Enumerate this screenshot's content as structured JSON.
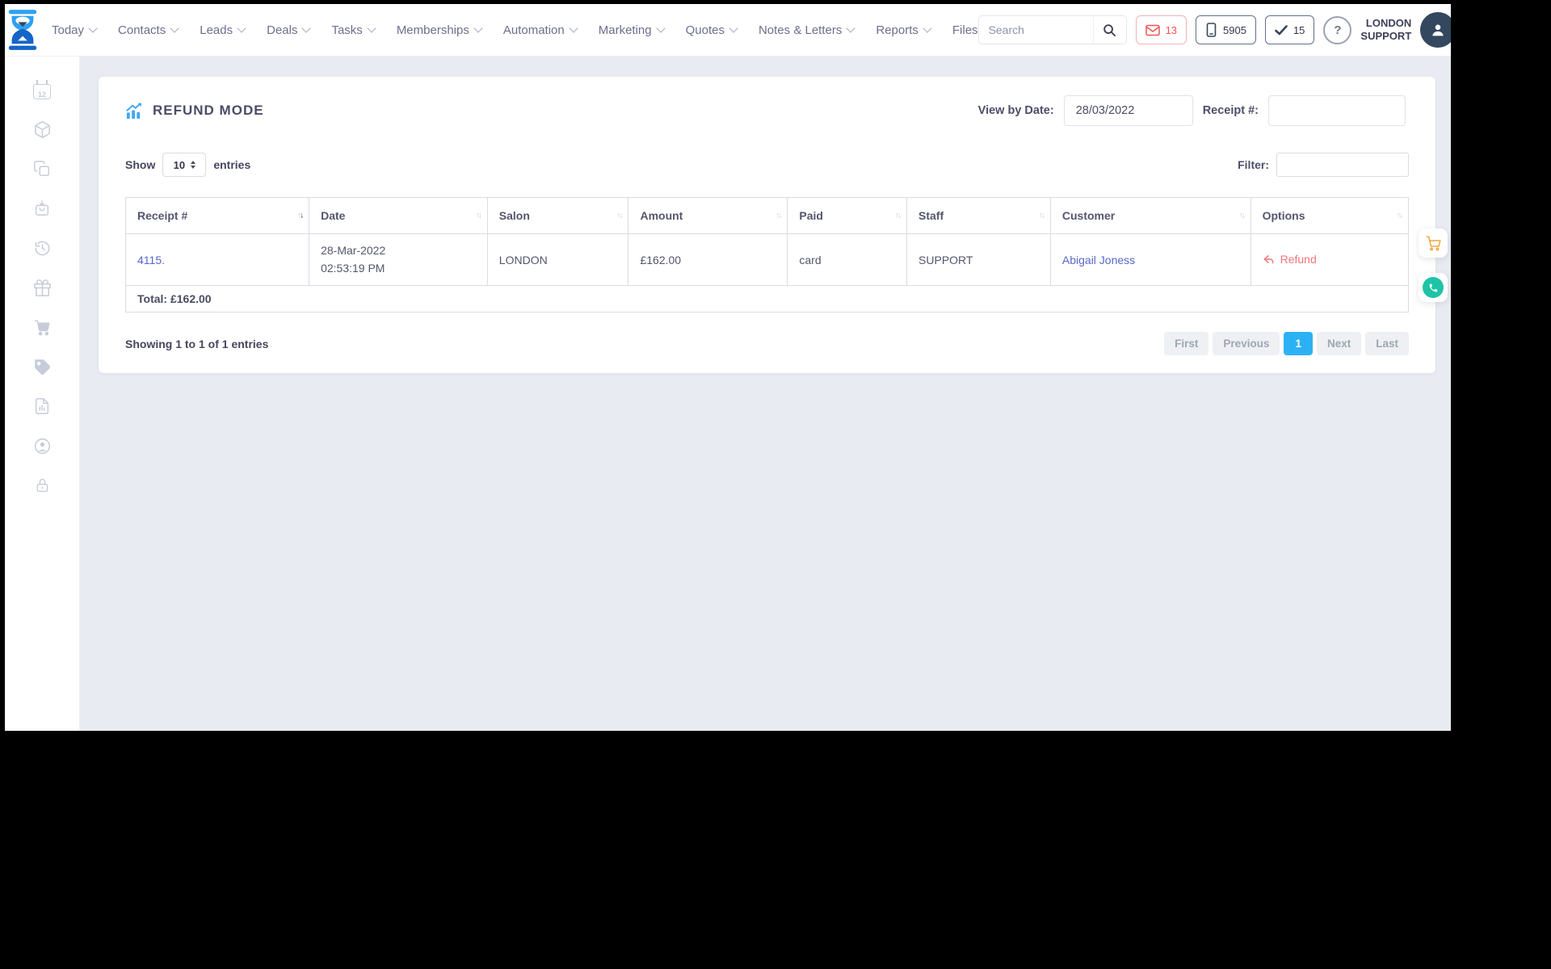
{
  "topbar": {
    "nav": [
      {
        "label": "Today",
        "dropdown": true
      },
      {
        "label": "Contacts",
        "dropdown": true
      },
      {
        "label": "Leads",
        "dropdown": true
      },
      {
        "label": "Deals",
        "dropdown": true
      },
      {
        "label": "Tasks",
        "dropdown": true
      },
      {
        "label": "Memberships",
        "dropdown": true
      },
      {
        "label": "Automation",
        "dropdown": true
      },
      {
        "label": "Marketing",
        "dropdown": true
      },
      {
        "label": "Quotes",
        "dropdown": true
      },
      {
        "label": "Notes & Letters",
        "dropdown": true
      },
      {
        "label": "Reports",
        "dropdown": true
      },
      {
        "label": "Files",
        "dropdown": false
      }
    ],
    "search": {
      "placeholder": "Search",
      "icon": "search-icon"
    },
    "badges": [
      {
        "icon": "envelope-icon",
        "count": "13",
        "style": "red"
      },
      {
        "icon": "mobile-icon",
        "count": "5905",
        "style": "dark"
      },
      {
        "icon": "check-icon",
        "count": "15",
        "style": "dark"
      }
    ],
    "help_glyph": "?",
    "user": {
      "line1": "LONDON",
      "line2": "SUPPORT"
    }
  },
  "sidebar": {
    "icons": [
      "calendar-icon",
      "package-icon",
      "pages-icon",
      "bag-download-icon",
      "history-icon",
      "gift-icon",
      "cart-icon",
      "price-tag-icon",
      "report-icon",
      "account-icon",
      "lock-icon"
    ],
    "calendar_day": "12"
  },
  "page": {
    "title": "REFUND MODE",
    "title_icon": "chart-icon",
    "view_by_date_label": "View by Date:",
    "view_by_date_value": "28/03/2022",
    "receipt_filter_label": "Receipt #:",
    "receipt_filter_value": ""
  },
  "controls": {
    "show_label": "Show",
    "show_value": "10",
    "entries_label": "entries",
    "filter_label": "Filter:",
    "filter_value": ""
  },
  "table": {
    "columns": [
      {
        "label": "Receipt #",
        "sorted": "desc"
      },
      {
        "label": "Date",
        "sorted": "none"
      },
      {
        "label": "Salon",
        "sorted": "none"
      },
      {
        "label": "Amount",
        "sorted": "none"
      },
      {
        "label": "Paid",
        "sorted": "none"
      },
      {
        "label": "Staff",
        "sorted": "none"
      },
      {
        "label": "Customer",
        "sorted": "none"
      },
      {
        "label": "Options",
        "sorted": "none"
      }
    ],
    "rows": [
      {
        "receipt": "4115.",
        "date": "28-Mar-2022",
        "time": "02:53:19 PM",
        "salon": "LONDON",
        "amount": "£162.00",
        "paid": "card",
        "staff": "SUPPORT",
        "customer": "Abigail Joness",
        "option_label": "Refund",
        "option_icon": "return-arrow-icon"
      }
    ],
    "total": "Total: £162.00"
  },
  "footer": {
    "showing": "Showing 1 to 1 of 1 entries",
    "pages": [
      "First",
      "Previous",
      "1",
      "Next",
      "Last"
    ],
    "active_page": "1"
  },
  "floating": [
    {
      "icon": "cart-icon"
    },
    {
      "icon": "whatsapp-phone-icon"
    }
  ],
  "colors": {
    "accent_blue": "#2ea1f2",
    "logo_dark_blue": "#1565c8",
    "link_blue": "#5a67c8",
    "refund_red": "#f4747c",
    "badge_red": "#ef5350",
    "active_page_blue": "#2db1f5",
    "cart_orange": "#f2a63b",
    "phone_teal": "#1ec3a6",
    "background": "#e9ebf2"
  }
}
